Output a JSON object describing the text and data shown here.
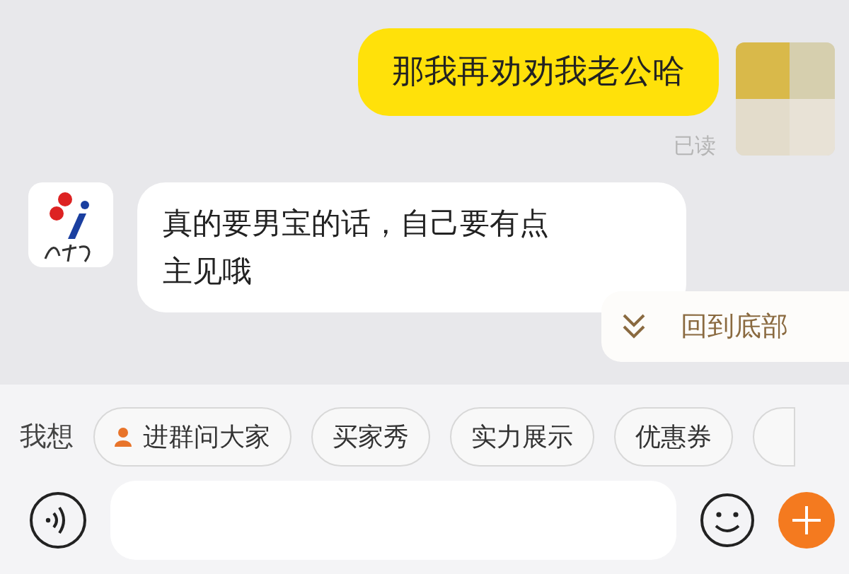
{
  "messages": [
    {
      "kind": "outgoing",
      "text": "那我再劝劝我老公哈",
      "status": "已读"
    },
    {
      "kind": "incoming",
      "text": "真的要男宝的话，自己要有点主见哦"
    }
  ],
  "scroll_to_bottom": {
    "label": "回到底部"
  },
  "quick_replies": {
    "label": "我想",
    "chips": [
      {
        "kind": "group",
        "text": "进群问大家"
      },
      {
        "kind": "plain",
        "text": "买家秀"
      },
      {
        "kind": "plain",
        "text": "实力展示"
      },
      {
        "kind": "plain",
        "text": "优惠券"
      }
    ]
  }
}
